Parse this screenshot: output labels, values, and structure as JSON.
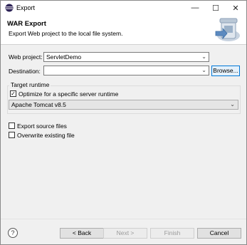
{
  "window": {
    "title": "Export",
    "minimize": "—",
    "maximize": "☐",
    "close": "✕"
  },
  "banner": {
    "title": "WAR Export",
    "description": "Export Web project to the local file system."
  },
  "form": {
    "web_project_label": "Web project:",
    "web_project_value": "ServletDemo",
    "destination_label": "Destination:",
    "destination_value": "",
    "browse_label": "Browse...",
    "target_runtime_label": "Target runtime",
    "optimize_label": "Optimize for a specific server runtime",
    "optimize_checked": true,
    "runtime_value": "Apache Tomcat v8.5",
    "export_source_label": "Export source files",
    "export_source_checked": false,
    "overwrite_label": "Overwrite existing file",
    "overwrite_checked": false
  },
  "footer": {
    "help_glyph": "?",
    "back_label": "< Back",
    "next_label": "Next >",
    "finish_label": "Finish",
    "cancel_label": "Cancel"
  },
  "colors": {
    "accent": "#0078d7",
    "window_bg": "#f0f0f0"
  }
}
